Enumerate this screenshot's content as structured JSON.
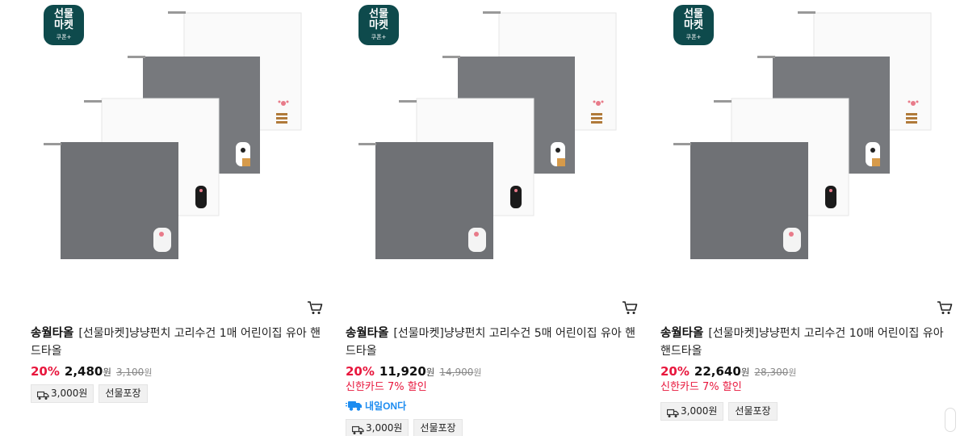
{
  "badge": {
    "line1": "선물",
    "line2": "마켓",
    "line3": "쿠폰+"
  },
  "products": [
    {
      "brand": "송월타올",
      "name": "[선물마켓]냥냥펀치 고리수건 1매 어린이집 유아 핸드타올",
      "rate": "20%",
      "price": "2,480",
      "currency": "원",
      "original_price": "3,100",
      "original_currency": "원",
      "card_promo": "",
      "delivery_badge": "",
      "shipping_fee": "3,000원",
      "gift_wrap": "선물포장"
    },
    {
      "brand": "송월타올",
      "name": "[선물마켓]냥냥펀치 고리수건 5매 어린이집 유아 핸드타올",
      "rate": "20%",
      "price": "11,920",
      "currency": "원",
      "original_price": "14,900",
      "original_currency": "원",
      "card_promo": "신한카드 7% 할인",
      "delivery_badge": "내일ON다",
      "shipping_fee": "3,000원",
      "gift_wrap": "선물포장"
    },
    {
      "brand": "송월타올",
      "name": "[선물마켓]냥냥펀치 고리수건 10매 어린이집 유아 핸드타올",
      "rate": "20%",
      "price": "22,640",
      "currency": "원",
      "original_price": "28,300",
      "original_currency": "원",
      "card_promo": "신한카드 7% 할인",
      "delivery_badge": "",
      "shipping_fee": "3,000원",
      "gift_wrap": "선물포장"
    }
  ],
  "colors": {
    "badge_bg": "#0e4a4c",
    "discount": "#e8173d",
    "towel_gray": "#6f7175",
    "tomorrow_blue": "#1d8cf0"
  },
  "icons": [
    "cart-icon",
    "truck-icon",
    "paw-icon"
  ]
}
